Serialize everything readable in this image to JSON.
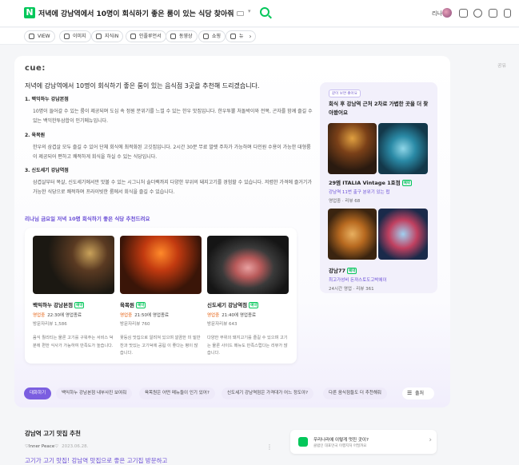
{
  "header": {
    "logo": "N",
    "query": "저녁에 강남역에서 10명이 회식하기 좋은 룸이 있는 식당 찾아줘",
    "user": "리나"
  },
  "tabs": [
    {
      "label": "VIEW"
    },
    {
      "label": "이미지"
    },
    {
      "label": "지식iN"
    },
    {
      "label": "인플루언서"
    },
    {
      "label": "동영상"
    },
    {
      "label": "쇼핑"
    },
    {
      "label": "뉴"
    }
  ],
  "more_label": "···",
  "share_label": "공유",
  "answer": {
    "brand": "cue:",
    "intro": "저녁에 강남역에서 10명이 회식하기 좋은 룸이 있는 음식점 3곳을 추천해 드리겠습니다.",
    "sections": [
      {
        "title": "1.   백익하누 강남본점",
        "body": "10명이 들어갈 수 있는 룸이 제공되며 도심 속 정원 분위기를 느낄 수 있는 한우 맛집입니다. 한우투뿔 처돌박이와 전복, 곤자를 함께 즐길 수 있는 백익한투삼합이 인기메뉴입니다."
      },
      {
        "title": "2.   육목원",
        "body": "한우의 삼겹살 모두 즐길 수 있어 단체 회식에 최적화된 고깃집입니다. 2시간 30분 무료 발렛 주차가 가능하며 다인원 수용이 가능한 대형룸이 제공되어 편하고 쾌적하게 회식을 하실 수 있는 식당입니다."
      },
      {
        "title": "3.   신도세기 강남역점",
        "body": "삼겹살부터 목살, 신도세기에서만 맛볼 수 있는 시그니처 솔더랙까지 다양한 부위의 돼지고기를 경험할 수 있습니다. 저렴한 가격에 즐거기가 가능한 식당으로 쾌적하며 프라이빗한 룸에서 회식을 즐길 수 있습니다."
      }
    ],
    "reco_title": "리나님 금요일 저녁 10명 회식하기 좋은 식당 추천드려요",
    "cards": [
      {
        "name": "백익하누 강남본점",
        "badge": "예약",
        "open": "영업중",
        "hours": "22:30에 영업종료",
        "reviews": "방문자리뷰 1,586",
        "desc": "음식 퀄리티는 물론 고기를 구워주는 서비스 덕분에 편한 식사가 가능하여 만족도가 높습니다."
      },
      {
        "name": "육목원",
        "badge": "예약",
        "open": "영업중",
        "hours": "21:50에 영업종료",
        "reviews": "방문자리뷰 760",
        "desc": "꽃등심 맛집으로 알려져 있으며 깔끔한 미 밑반찬과 맛있는 고기덕에 공됩 이 좋다는 평이 많습니다."
      },
      {
        "name": "신도세기 강남역점",
        "badge": "예약",
        "open": "영업중",
        "hours": "21:40에 영업종료",
        "reviews": "방문자리뷰 643",
        "desc": "다양한 부위의 돼지고기를 즐길 수 있으며 고기는 물론 사이드 메뉴도 만족스럽다는 리뷰가 많습니다."
      }
    ]
  },
  "sidebar": {
    "tag": "같이 보면 좋아요",
    "title": "회식 후 강남역 근처 2차로 가볍한 곳을 더 찾아봤어요",
    "places": [
      {
        "name": "29엠 ITALIA Vintage 1호점",
        "badge": "예약",
        "sub": "강남역 11번 출구 분위기 있는 펍",
        "meta": "영업중 · 리뷰 68"
      },
      {
        "name": "강남77",
        "badge": "예약",
        "sub": "최고가성비 돈까스토도고박에이",
        "meta": "24시간 영업 · 리뷰 361"
      }
    ]
  },
  "chips": [
    {
      "label": "대화하기"
    },
    {
      "label": "백익하누 강남본점 내부사진 보여줘"
    },
    {
      "label": "육목원은 어떤 메뉴들이 인기 있어?"
    },
    {
      "label": "신도세기 강남역점은 가격대가 어느 정도야?"
    },
    {
      "label": "다른 음식점들도 더 추천해줘"
    },
    {
      "label": "출처"
    }
  ],
  "result": {
    "title": "강남역 고기 맛집 추천",
    "author": "♡Inner Peace♡",
    "date": "2023.06.28.",
    "link": "고기가 고기 맛집! 강남역 맛집으로 좋은 고기집 방문하고"
  },
  "promo": {
    "title": "우리나라에 이렇게 멋진 곳이?",
    "sub": "클럽인 대표먼국 이행지처 어떨까요"
  },
  "colors": {
    "accent": "#7b5ee0",
    "brand": "#03c75a"
  }
}
